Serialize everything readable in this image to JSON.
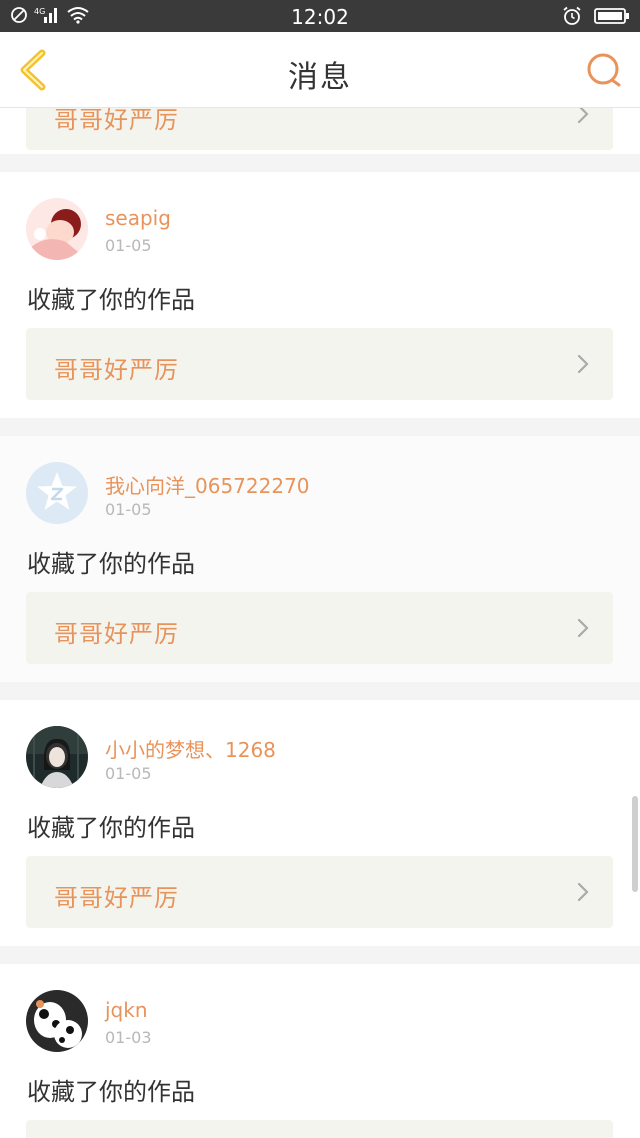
{
  "status_bar": {
    "time": "12:02",
    "network": "4G"
  },
  "nav": {
    "title": "消息",
    "back_icon": "chevron-left-icon",
    "search_icon": "search-icon"
  },
  "colors": {
    "accent": "#e8935a",
    "back_icon": "#f2c230",
    "text": "#333333",
    "date": "#b8b8b8",
    "work_box_bg": "#f4f4ef"
  },
  "messages": [
    {
      "username": "",
      "date": "",
      "action": "",
      "work_title": "哥哥好严厉"
    },
    {
      "username": "seapig",
      "date": "01-05",
      "action": "收藏了你的作品",
      "work_title": "哥哥好严厉",
      "avatar": "illustrated-girl-avatar"
    },
    {
      "username": "我心向洋_065722270",
      "date": "01-05",
      "action": "收藏了你的作品",
      "work_title": "哥哥好严厉",
      "avatar": "qq-default-avatar"
    },
    {
      "username": "小小的梦想、1268",
      "date": "01-05",
      "action": "收藏了你的作品",
      "work_title": "哥哥好严厉",
      "avatar": "photo-avatar"
    },
    {
      "username": "jqkn",
      "date": "01-03",
      "action": "收藏了你的作品",
      "work_title": "",
      "avatar": "cartoon-cow-avatar"
    }
  ]
}
